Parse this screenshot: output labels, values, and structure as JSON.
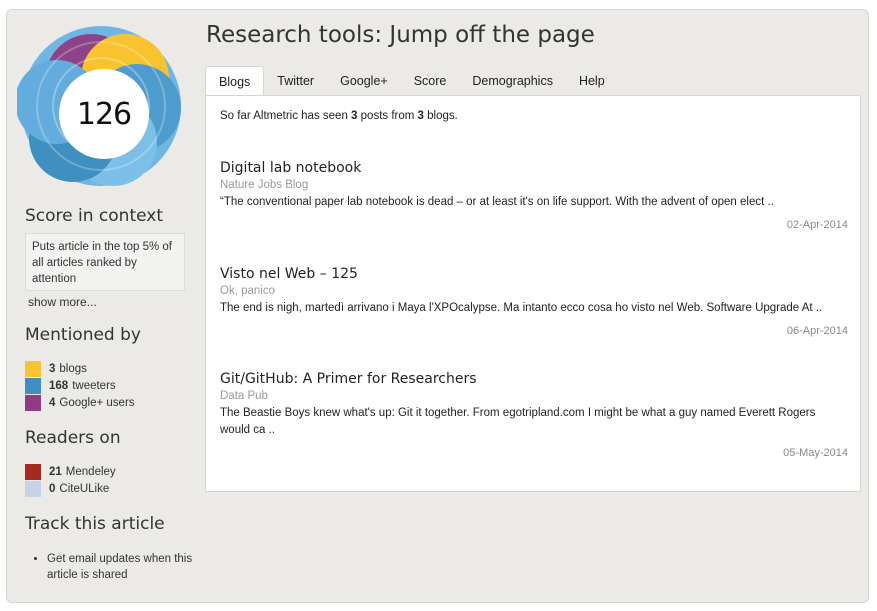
{
  "score": "126",
  "donut_colors": [
    "#f9c32f",
    "#8e3d85",
    "#3f8fc0",
    "#6fb6e3"
  ],
  "sidebar": {
    "context_heading": "Score in context",
    "context_text": "Puts article in the top 5% of all articles ranked by attention",
    "show_more": "show more...",
    "mentioned_heading": "Mentioned by",
    "mentioned": [
      {
        "count": "3",
        "label": "blogs",
        "color": "#f9c32f"
      },
      {
        "count": "168",
        "label": "tweeters",
        "color": "#3f8fc0"
      },
      {
        "count": "4",
        "label": "Google+ users",
        "color": "#8e3d85"
      }
    ],
    "readers_heading": "Readers on",
    "readers": [
      {
        "count": "21",
        "label": "Mendeley",
        "color": "#a52a1f"
      },
      {
        "count": "0",
        "label": "CiteULike",
        "color": "#c4d3e6"
      }
    ],
    "track_heading": "Track this article",
    "track_items": [
      "Get email updates when this article is shared"
    ]
  },
  "main": {
    "title": "Research tools: Jump off the page",
    "tabs": [
      "Blogs",
      "Twitter",
      "Google+",
      "Score",
      "Demographics",
      "Help"
    ],
    "active_tab": "Blogs",
    "summary": {
      "pre": "So far Altmetric has seen ",
      "posts": "3",
      "mid": " posts from ",
      "blogs": "3",
      "post": " blogs."
    },
    "posts": [
      {
        "title": "Digital lab notebook",
        "source": "Nature Jobs Blog",
        "excerpt": "“The conventional paper lab notebook is dead – or at least it's on life support. With the advent of open elect ..",
        "date": "02-Apr-2014"
      },
      {
        "title": "Visto nel Web – 125",
        "source": "Ok, panico",
        "excerpt": "The end is nigh, martedì arrivano i Maya l'XPOcalypse. Ma intanto ecco cosa ho visto nel Web. Software Upgrade At ..",
        "date": "06-Apr-2014"
      },
      {
        "title": "Git/GitHub: A Primer for Researchers",
        "source": "Data Pub",
        "excerpt": "The Beastie Boys knew what's up: Git it together. From egotripland.com I might be what a guy named Everett Rogers would ca ..",
        "date": "05-May-2014"
      }
    ]
  }
}
